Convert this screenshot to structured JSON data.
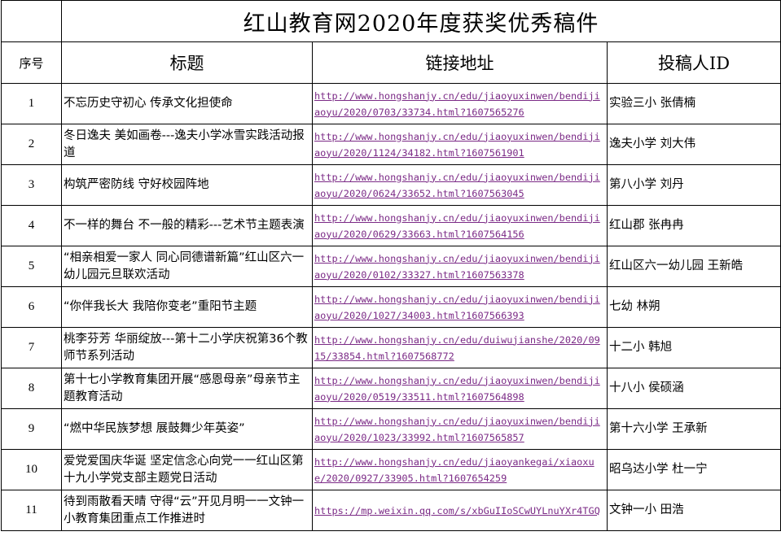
{
  "sheet_title": "红山教育网2020年度获奖优秀稿件",
  "headers": {
    "no": "序号",
    "title": "标题",
    "link": "链接地址",
    "author": "投稿人ID"
  },
  "link_color": "#7b2a86",
  "rows": [
    {
      "no": "1",
      "title": "不忘历史守初心 传承文化担使命",
      "link": "http://www.hongshanjy.cn/edu/jiaoyuxinwen/bendijiaoyu/2020/0703/33734.html?1607565276",
      "author": "实验三小 张倩楠"
    },
    {
      "no": "2",
      "title": "冬日逸夫 美如画卷---逸夫小学冰雪实践活动报道",
      "link": "http://www.hongshanjy.cn/edu/jiaoyuxinwen/bendijiaoyu/2020/1124/34182.html?1607561901",
      "author": "逸夫小学 刘大伟"
    },
    {
      "no": "3",
      "title": "构筑严密防线 守好校园阵地",
      "link": "http://www.hongshanjy.cn/edu/jiaoyuxinwen/bendijiaoyu/2020/0624/33652.html?1607563045",
      "author": "第八小学 刘丹"
    },
    {
      "no": "4",
      "title": "不一样的舞台 不一般的精彩---艺术节主题表演",
      "link": "http://www.hongshanjy.cn/edu/jiaoyuxinwen/bendijiaoyu/2020/0629/33663.html?1607564156",
      "author": "红山郡 张冉冉"
    },
    {
      "no": "5",
      "title": "“相亲相爱一家人 同心同德谱新篇”红山区六一幼儿园元旦联欢活动",
      "link": "http://www.hongshanjy.cn/edu/jiaoyuxinwen/bendijiaoyu/2020/0102/33327.html?1607563378",
      "author": "红山区六一幼儿园 王新皓"
    },
    {
      "no": "6",
      "title": "“你伴我长大 我陪你变老”重阳节主题",
      "link": "http://www.hongshanjy.cn/edu/jiaoyuxinwen/bendijiaoyu/2020/1027/34003.html?1607566393",
      "author": "七幼 林朔"
    },
    {
      "no": "7",
      "title": "桃李芬芳 华丽绽放---第十二小学庆祝第36个教师节系列活动",
      "link": "http://www.hongshanjy.cn/edu/duiwujianshe/2020/0915/33854.html?1607568772",
      "author": "十二小 韩旭"
    },
    {
      "no": "8",
      "title": "第十七小学教育集团开展“感恩母亲”母亲节主题教育活动",
      "link": "http://www.hongshanjy.cn/edu/jiaoyuxinwen/bendijiaoyu/2020/0519/33511.html?1607564898",
      "author": "十八小 侯硕涵"
    },
    {
      "no": "9",
      "title": "“燃中华民族梦想 展鼓舞少年英姿”",
      "link": "http://www.hongshanjy.cn/edu/jiaoyuxinwen/bendijiaoyu/2020/1023/33992.html?1607565857",
      "author": "第十六小学 王承新"
    },
    {
      "no": "10",
      "title": "爱党爱国庆华诞 坚定信念心向党一一红山区第十九小学党支部主题党日活动",
      "link": "http://www.hongshanjy.cn/edu/jiaoyankegai/xiaoxue/2020/0927/33905.html?1607654259",
      "author": "昭乌达小学 杜一宁"
    },
    {
      "no": "11",
      "title": "待到雨散看天晴 守得“云”开见月明一一文钟一小教育集团重点工作推进时",
      "link": "https://mp.weixin.qq.com/s/xbGuIIoSCwUYLnuYXr4TGQ",
      "author": "文钟一小 田浩"
    }
  ]
}
